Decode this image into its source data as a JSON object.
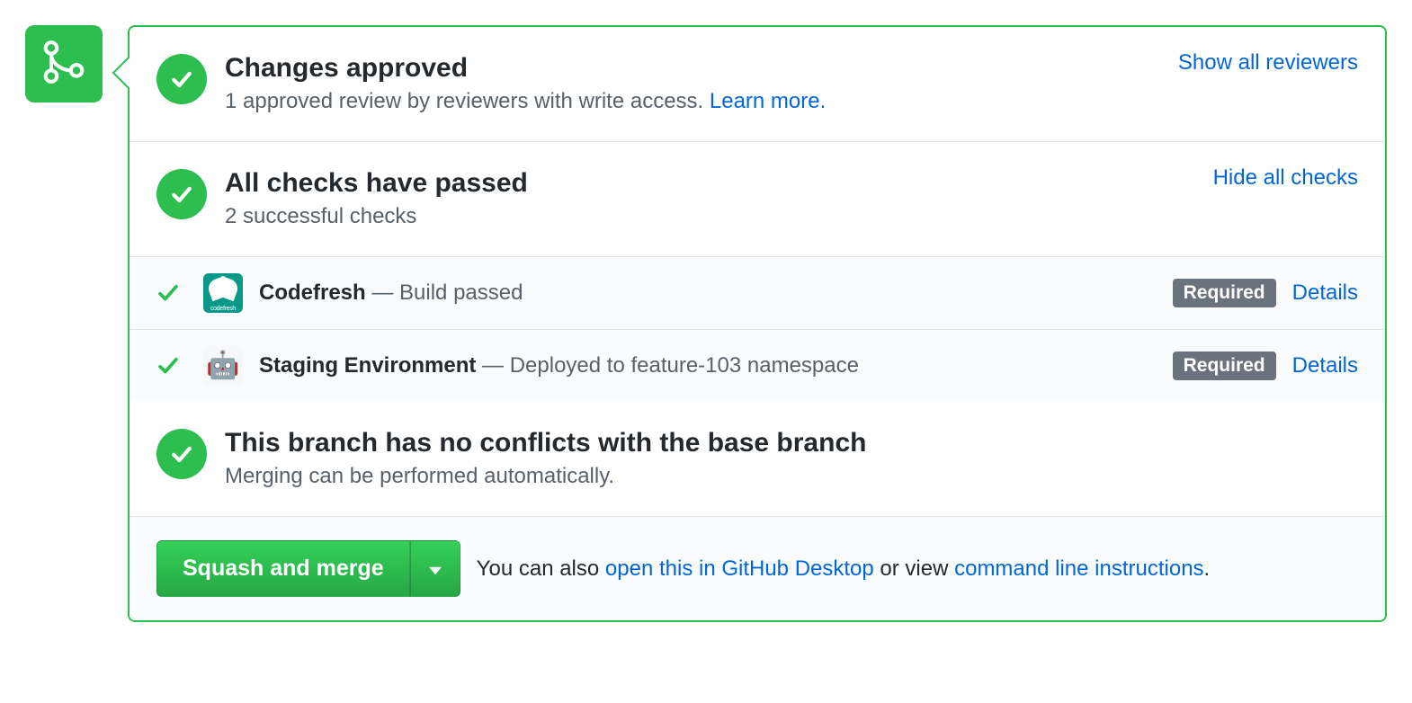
{
  "approved": {
    "title": "Changes approved",
    "subtitle": "1 approved review by reviewers with write access. ",
    "learn_more": "Learn more.",
    "toggle": "Show all reviewers"
  },
  "checks": {
    "title": "All checks have passed",
    "subtitle": "2 successful checks",
    "toggle": "Hide all checks",
    "items": [
      {
        "name": "Codefresh",
        "status": "Build passed",
        "required": "Required",
        "details": "Details",
        "avatar": "codefresh"
      },
      {
        "name": "Staging Environment",
        "status": "Deployed to feature-103 namespace",
        "required": "Required",
        "details": "Details",
        "avatar": "robot"
      }
    ]
  },
  "conflicts": {
    "title": "This branch has no conflicts with the base branch",
    "subtitle": "Merging can be performed automatically."
  },
  "footer": {
    "button": "Squash and merge",
    "text_prefix": "You can also ",
    "open_desktop": "open this in GitHub Desktop",
    "text_middle": " or view ",
    "cmd_line": "command line instructions",
    "text_suffix": "."
  }
}
